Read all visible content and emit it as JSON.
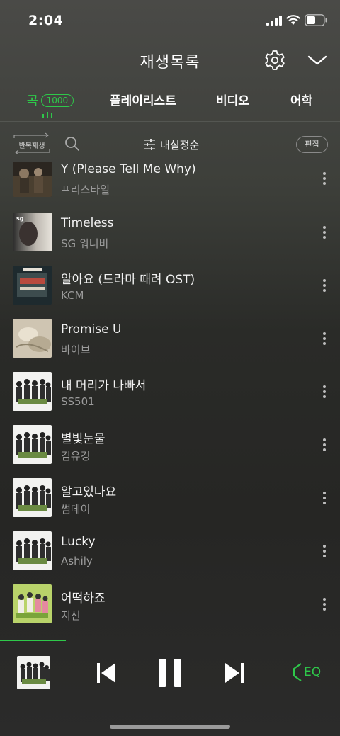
{
  "status_bar": {
    "time": "2:04"
  },
  "header": {
    "title": "재생목록",
    "settings_icon": "gear-icon",
    "collapse_icon": "chevron-down-icon"
  },
  "tabs": [
    {
      "label": "곡",
      "badge": "1000",
      "active": true
    },
    {
      "label": "플레이리스트"
    },
    {
      "label": "비디오"
    },
    {
      "label": "어학"
    }
  ],
  "toolbar": {
    "repeat_label": "반복재생",
    "sort_label": "내설정순",
    "edit_label": "편집"
  },
  "songs": [
    {
      "title": "Y (Please Tell Me Why)",
      "artist": "프리스타일",
      "art": "dark"
    },
    {
      "title": "Timeless",
      "artist": "SG 워너비",
      "art": "sg"
    },
    {
      "title": "알아요 (드라마 때려 OST)",
      "artist": "KCM",
      "art": "red"
    },
    {
      "title": "Promise U",
      "artist": "바이브",
      "art": "beige"
    },
    {
      "title": "내 머리가 나빠서",
      "artist": "SS501",
      "art": "group"
    },
    {
      "title": "별빛눈물",
      "artist": "김유경",
      "art": "group"
    },
    {
      "title": "알고있나요",
      "artist": "썸데이",
      "art": "group"
    },
    {
      "title": "Lucky",
      "artist": "Ashily",
      "art": "group"
    },
    {
      "title": "어떡하죠",
      "artist": "지선",
      "art": "greengroup"
    }
  ],
  "player": {
    "eq_label": "EQ",
    "accent": "#2ec84a"
  }
}
